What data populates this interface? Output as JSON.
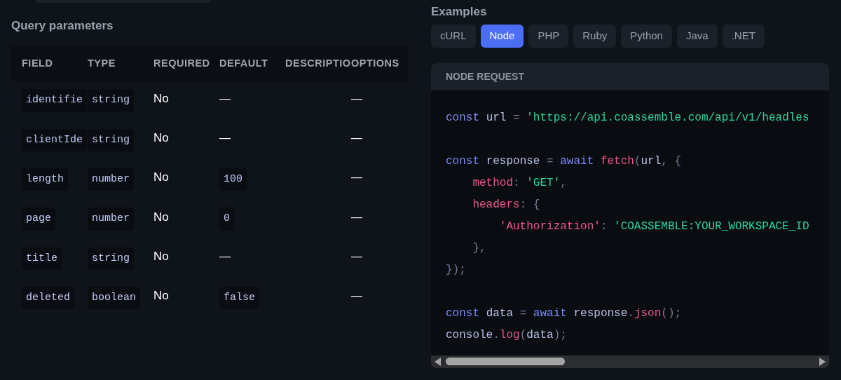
{
  "query_parameters": {
    "title": "Query parameters",
    "columns": [
      "FIELD",
      "TYPE",
      "REQUIRED",
      "DEFAULT",
      "DESCRIPTIO",
      "OPTIONS"
    ],
    "rows": [
      {
        "field": "identifie",
        "type": "string",
        "required": "No",
        "default": {
          "kind": "dash",
          "text": "—"
        },
        "options": "—"
      },
      {
        "field": "clientIde",
        "type": "string",
        "required": "No",
        "default": {
          "kind": "dash",
          "text": "—"
        },
        "options": "—"
      },
      {
        "field": "length",
        "type": "number",
        "required": "No",
        "default": {
          "kind": "code",
          "text": "100"
        },
        "options": "—"
      },
      {
        "field": "page",
        "type": "number",
        "required": "No",
        "default": {
          "kind": "code",
          "text": "0"
        },
        "options": "—"
      },
      {
        "field": "title",
        "type": "string",
        "required": "No",
        "default": {
          "kind": "dash",
          "text": "—"
        },
        "options": "—"
      },
      {
        "field": "deleted",
        "type": "boolean",
        "required": "No",
        "default": {
          "kind": "code",
          "text": "false"
        },
        "options": "—"
      }
    ]
  },
  "examples": {
    "title": "Examples",
    "tabs": [
      {
        "label": "cURL",
        "selected": false
      },
      {
        "label": "Node",
        "selected": true
      },
      {
        "label": "PHP",
        "selected": false
      },
      {
        "label": "Ruby",
        "selected": false
      },
      {
        "label": "Python",
        "selected": false
      },
      {
        "label": "Java",
        "selected": false
      },
      {
        "label": ".NET",
        "selected": false
      }
    ],
    "code_title": "NODE REQUEST",
    "code_lines": [
      {
        "kind": "code",
        "text": "const url = 'https://api.coassemble.com/api/v1/headles"
      },
      {
        "kind": "blank"
      },
      {
        "kind": "code",
        "text": "const response = await fetch(url, {"
      },
      {
        "kind": "code",
        "text": "    method: 'GET',"
      },
      {
        "kind": "code",
        "text": "    headers: {"
      },
      {
        "kind": "code",
        "text": "        'Authorization': 'COASSEMBLE:YOUR_WORKSPACE_ID"
      },
      {
        "kind": "code",
        "text": "    },"
      },
      {
        "kind": "code",
        "text": "});"
      },
      {
        "kind": "blank"
      },
      {
        "kind": "code",
        "text": "const data = await response.json();"
      },
      {
        "kind": "code",
        "text": "console.log(data);"
      }
    ]
  }
}
